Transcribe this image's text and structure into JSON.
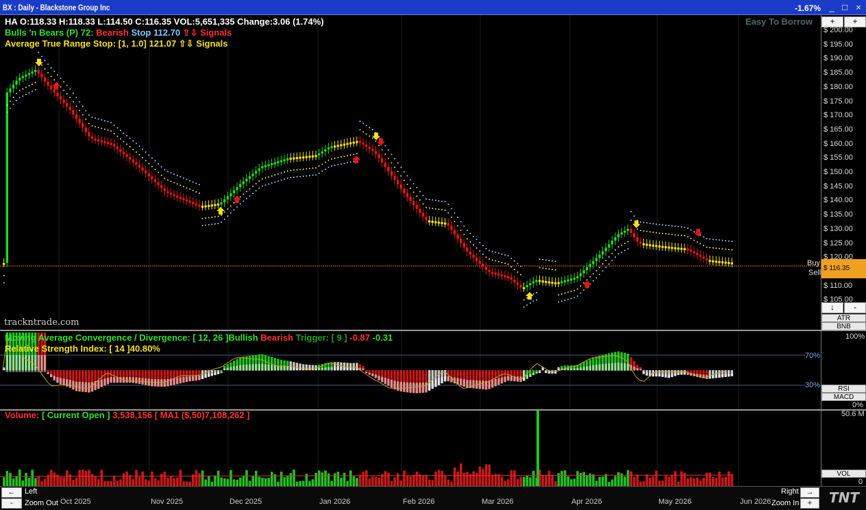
{
  "window": {
    "title": "BX : Daily  -  Blackstone Group Inc",
    "change_pct": "-1.67%",
    "controls": [
      "_",
      "□",
      "×"
    ]
  },
  "price_pane": {
    "ohlc": "HA O:118.33   H:118.33   L:114.50   C:116.35   VOL:5,651,335   Change:3.06 (1.74%)",
    "bnb": {
      "name": "Bulls 'n Bears (P) 72:",
      "state": "Bearish",
      "stop_label": "Stop",
      "stop_value": "112.70",
      "signals": "⇧⇩ Signals"
    },
    "atr": {
      "text": "Average True Range Stop: [1, 1.0] 121.07 ⇧⇩ Signals"
    },
    "easy_to_borrow": "Easy To Borrow",
    "watermark": "trackntrade.com",
    "price_labels": [
      "$ 200.00",
      "$ 195.00",
      "$ 190.00",
      "$ 185.00",
      "$ 180.00",
      "$ 175.00",
      "$ 170.00",
      "$ 165.00",
      "$ 160.00",
      "$ 155.00",
      "$ 150.00",
      "$ 145.00",
      "$ 140.00",
      "$ 135.00",
      "$ 130.00",
      "$ 125.00",
      "$ 120.00",
      "$ 115.00",
      "$ 110.00",
      "$ 105.00"
    ],
    "buy_label": "Buy",
    "sell_label": "Sell",
    "current_price": "$ 116.35",
    "side_buttons": [
      "ATR",
      "BNB"
    ],
    "zoom_buttons": [
      "+",
      "-"
    ]
  },
  "indicator_pane": {
    "macd": {
      "prefix": "Moving Average Convergence / Divergence: [ 12, 26 ]",
      "bullish": "Bullish",
      "bearish": "Bearish",
      "trigger": "Trigger: [ 9 ]",
      "v1": "-0.87",
      "v2": "-0.31"
    },
    "rsi": {
      "text": "Relative Strength Index: [ 14 ]40.80%"
    },
    "levels": [
      "100%",
      "70%",
      "30%",
      "0%"
    ],
    "side_buttons": [
      "RSI",
      "MACD"
    ]
  },
  "volume_pane": {
    "prefix": "Volume:",
    "current": "[ Current Open ]",
    "current_value": "3,538,156",
    "ma": "[ MA1 ($,50)7,108,262 ]",
    "scale_top": "50.6 M",
    "scale_bottom": "0",
    "side_button": "VOL"
  },
  "navigation": {
    "left_arrow": "←",
    "left": "Left",
    "zoom_out_btn": "-",
    "zoom_out": "Zoom Out",
    "right": "Right",
    "right_arrow": "→",
    "zoom_in": "Zoom In",
    "zoom_in_btn": "+",
    "logo": "TNT"
  },
  "dates": [
    "Oct 2025",
    "Nov 2025",
    "Dec 2025",
    "Jan 2026",
    "Feb 2026",
    "Mar 2026",
    "Apr 2026",
    "May 2026",
    "Jun 2026"
  ],
  "colors": {
    "bull": "#20d020",
    "bear": "#e02020",
    "neutral": "#f0e020",
    "titlebar": "#1a3cc8",
    "atr_dots": "#8fd0ff"
  }
}
